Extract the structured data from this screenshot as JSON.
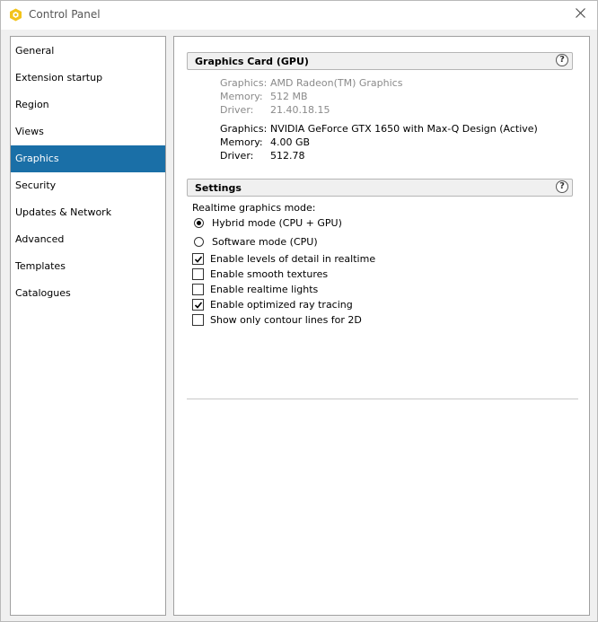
{
  "window": {
    "title": "Control Panel",
    "icon": "app-hexagon-icon",
    "close_icon": "close-icon"
  },
  "colors": {
    "accent": "#1a6fa7",
    "app_icon": "#f2c31a"
  },
  "sidebar": {
    "items": [
      {
        "label": "General"
      },
      {
        "label": "Extension startup"
      },
      {
        "label": "Region"
      },
      {
        "label": "Views"
      },
      {
        "label": "Graphics",
        "active": true
      },
      {
        "label": "Security"
      },
      {
        "label": "Updates & Network"
      },
      {
        "label": "Advanced"
      },
      {
        "label": "Templates"
      },
      {
        "label": "Catalogues"
      }
    ]
  },
  "gpu_section": {
    "title": "Graphics Card (GPU)",
    "help": "?",
    "cards": [
      {
        "graphics_label": "Graphics:",
        "graphics_value": "AMD Radeon(TM) Graphics",
        "memory_label": "Memory:",
        "memory_value": "512 MB",
        "driver_label": "Driver:",
        "driver_value": "21.40.18.15",
        "active": false
      },
      {
        "graphics_label": "Graphics:",
        "graphics_value": "NVIDIA GeForce GTX 1650 with Max-Q Design (Active)",
        "memory_label": "Memory:",
        "memory_value": "4.00 GB",
        "driver_label": "Driver:",
        "driver_value": "512.78",
        "active": true
      }
    ]
  },
  "settings_section": {
    "title": "Settings",
    "help": "?",
    "mode_label": "Realtime graphics mode:",
    "radios": [
      {
        "label": "Hybrid mode (CPU + GPU)",
        "selected": true
      },
      {
        "label": "Software mode (CPU)",
        "selected": false
      }
    ],
    "checkboxes": [
      {
        "label": "Enable levels of detail in realtime",
        "checked": true
      },
      {
        "label": "Enable smooth textures",
        "checked": false
      },
      {
        "label": "Enable realtime lights",
        "checked": false
      },
      {
        "label": "Enable optimized ray tracing",
        "checked": true
      },
      {
        "label": "Show only contour lines for 2D",
        "checked": false
      }
    ]
  }
}
